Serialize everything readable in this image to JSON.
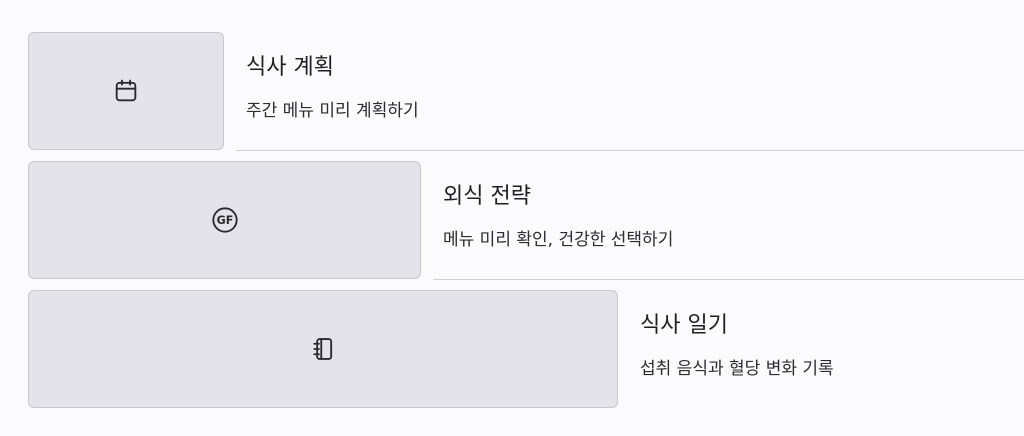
{
  "items": [
    {
      "title": "식사 계획",
      "subtitle": "주간 메뉴 미리 계획하기",
      "icon": "calendar-icon"
    },
    {
      "title": "외식 전략",
      "subtitle": "메뉴 미리 확인, 건강한 선택하기",
      "icon": "gluten-free-icon",
      "icon_text": "GF"
    },
    {
      "title": "식사 일기",
      "subtitle": "섭취 음식과 혈당 변화 기록",
      "icon": "notebook-icon"
    }
  ],
  "colors": {
    "background": "#fbfbfd",
    "thumbnail": "#e3e3e9",
    "divider": "#cfcfd6"
  }
}
